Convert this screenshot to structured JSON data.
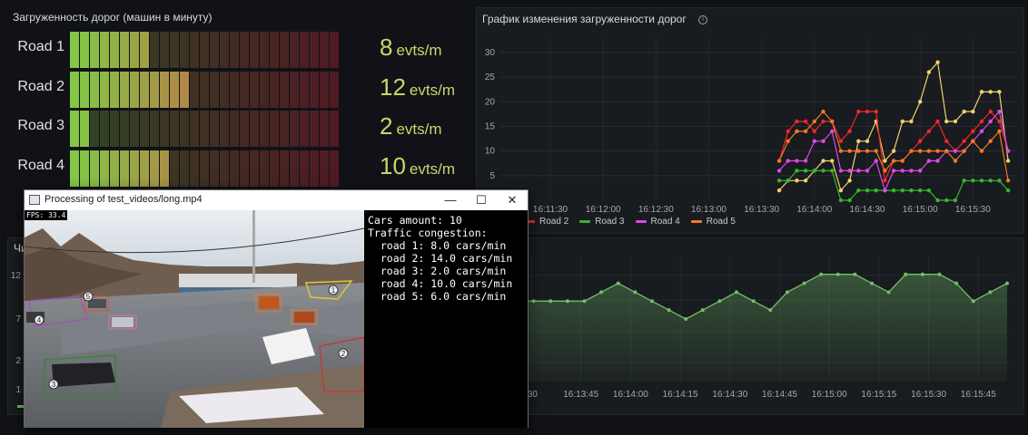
{
  "bar_panel": {
    "title": "Загруженность дорог (машин в минуту)",
    "unit": "evts/m",
    "segments_total": 27,
    "roads": [
      {
        "label": "Road 1",
        "value": "8",
        "fraction": 0.3
      },
      {
        "label": "Road 2",
        "value": "12",
        "fraction": 0.44
      },
      {
        "label": "Road 3",
        "value": "2",
        "fraction": 0.07
      },
      {
        "label": "Road 4",
        "value": "10",
        "fraction": 0.37
      }
    ]
  },
  "line_panel": {
    "title": "График изменения загруженности дорог",
    "y_ticks": [
      "30",
      "25",
      "20",
      "15",
      "10",
      "5"
    ],
    "x_ticks": [
      "16:11:30",
      "16:12:00",
      "16:12:30",
      "16:13:00",
      "16:13:30",
      "16:14:00",
      "16:14:30",
      "16:15:00",
      "16:15:30"
    ],
    "legend": [
      {
        "name": "Road 2",
        "color": "#f2272b"
      },
      {
        "name": "Road 3",
        "color": "#37b52f"
      },
      {
        "name": "Road 4",
        "color": "#e047e8"
      },
      {
        "name": "Road 5",
        "color": "#f27925"
      }
    ]
  },
  "bottom_panel": {
    "title_partial": "Чи",
    "y_ticks_partial": [
      "12",
      "7",
      "2",
      "1"
    ],
    "x_ticks": [
      "16:13:30",
      "16:13:45",
      "16:14:00",
      "16:14:15",
      "16:14:30",
      "16:14:45",
      "16:15:00",
      "16:15:15",
      "16:15:30",
      "16:15:45"
    ],
    "x_tick_first_visible": ":30"
  },
  "window": {
    "title": "Processing of test_videos/long.mp4",
    "minimize": "—",
    "maximize": "☐",
    "close": "✕",
    "fps": "FPS: 33.4",
    "console_lines": [
      "Cars amount: 10",
      "Traffic congestion:",
      "  road 1: 8.0 cars/min",
      "  road 2: 14.0 cars/min",
      "  road 3: 2.0 cars/min",
      "  road 4: 10.0 cars/min",
      "  road 5: 6.0 cars/min"
    ],
    "zone_numbers": [
      "1",
      "2",
      "3",
      "4",
      "5"
    ]
  },
  "chart_data": [
    {
      "type": "line",
      "title": "График изменения загруженности дорог",
      "ylim": [
        0,
        32
      ],
      "x": [
        "16:13:40",
        "16:13:45",
        "16:13:50",
        "16:13:55",
        "16:14:00",
        "16:14:05",
        "16:14:10",
        "16:14:15",
        "16:14:20",
        "16:14:25",
        "16:14:30",
        "16:14:35",
        "16:14:40",
        "16:14:45",
        "16:14:50",
        "16:14:55",
        "16:15:00",
        "16:15:05",
        "16:15:10",
        "16:15:15",
        "16:15:20",
        "16:15:25",
        "16:15:30",
        "16:15:35",
        "16:15:40",
        "16:15:45",
        "16:15:50"
      ],
      "series": [
        {
          "name": "Road 1",
          "color": "#f3d06b",
          "values": [
            2,
            4,
            4,
            4,
            6,
            8,
            8,
            2,
            4,
            12,
            12,
            16,
            8,
            10,
            16,
            16,
            20,
            26,
            28,
            16,
            16,
            18,
            18,
            22,
            22,
            22,
            8
          ]
        },
        {
          "name": "Road 2",
          "color": "#f2272b",
          "values": [
            8,
            14,
            16,
            16,
            14,
            16,
            16,
            12,
            14,
            18,
            18,
            18,
            4,
            8,
            8,
            10,
            12,
            14,
            16,
            12,
            10,
            12,
            14,
            16,
            18,
            16,
            10
          ]
        },
        {
          "name": "Road 3",
          "color": "#37b52f",
          "values": [
            4,
            4,
            6,
            6,
            6,
            6,
            6,
            0,
            0,
            2,
            2,
            2,
            2,
            2,
            2,
            2,
            2,
            2,
            0,
            0,
            0,
            4,
            4,
            4,
            4,
            4,
            2
          ]
        },
        {
          "name": "Road 4",
          "color": "#e047e8",
          "values": [
            6,
            8,
            8,
            8,
            12,
            12,
            14,
            6,
            6,
            6,
            6,
            8,
            2,
            6,
            6,
            6,
            6,
            8,
            8,
            10,
            10,
            10,
            12,
            14,
            16,
            18,
            10
          ]
        },
        {
          "name": "Road 5",
          "color": "#f27925",
          "values": [
            8,
            12,
            14,
            14,
            16,
            18,
            16,
            10,
            10,
            10,
            10,
            10,
            6,
            8,
            8,
            10,
            10,
            10,
            10,
            10,
            8,
            10,
            12,
            10,
            12,
            14,
            4
          ]
        }
      ]
    },
    {
      "type": "area",
      "x_range": [
        "16:13:30",
        "16:15:50"
      ],
      "series": [
        {
          "name": "",
          "color": "#73bf69",
          "values": [
            9,
            9,
            9,
            9,
            9,
            10,
            11,
            10,
            9,
            8,
            7,
            8,
            9,
            10,
            9,
            8,
            10,
            11,
            12,
            12,
            12,
            11,
            10,
            12,
            12,
            12,
            11,
            9,
            10,
            11
          ]
        }
      ]
    }
  ]
}
